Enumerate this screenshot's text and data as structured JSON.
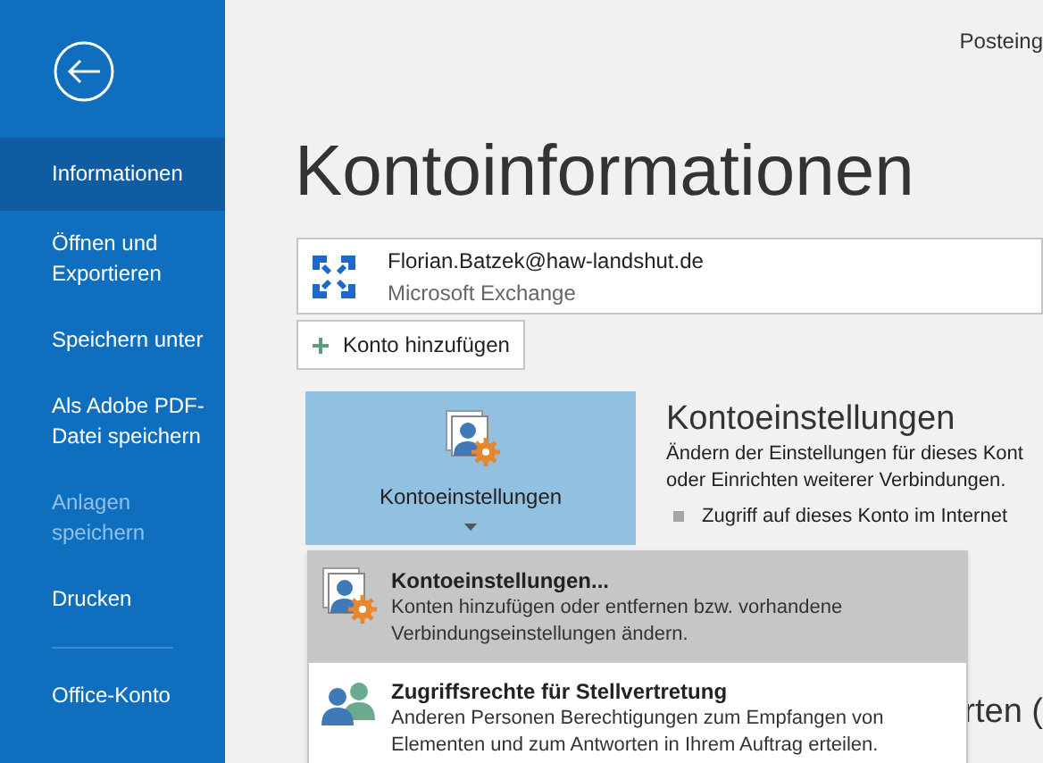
{
  "nav": {
    "items": [
      {
        "kind": "item",
        "label": "Informationen",
        "selected": true,
        "disabled": false
      },
      {
        "kind": "item",
        "label": "Öffnen und Exportieren",
        "selected": false,
        "disabled": false
      },
      {
        "kind": "item",
        "label": "Speichern unter",
        "selected": false,
        "disabled": false
      },
      {
        "kind": "item",
        "label": "Als Adobe PDF-Datei speichern",
        "selected": false,
        "disabled": false
      },
      {
        "kind": "item",
        "label": "Anlagen speichern",
        "selected": false,
        "disabled": true
      },
      {
        "kind": "item",
        "label": "Drucken",
        "selected": false,
        "disabled": false
      },
      {
        "kind": "divider"
      },
      {
        "kind": "item",
        "label": "Office-Konto",
        "selected": false,
        "disabled": false
      }
    ]
  },
  "header_right": "Posteing",
  "title": "Kontoinformationen",
  "account": {
    "email": "Florian.Batzek@haw-landshut.de",
    "type": "Microsoft Exchange"
  },
  "add_account_button": "Konto hinzufügen",
  "settings_tile": {
    "label": "Kontoeinstellungen"
  },
  "section": {
    "heading": "Kontoeinstellungen",
    "description": [
      "Ändern der Einstellungen für dieses Kont",
      "oder Einrichten weiterer Verbindungen."
    ],
    "bullet": "Zugriff auf dieses Konto im Internet"
  },
  "menu": {
    "items": [
      {
        "title": "Kontoeinstellungen...",
        "description": "Konten hinzufügen oder entfernen bzw. vorhandene Verbindungseinstellungen ändern.",
        "kind": "settings",
        "selected": true
      },
      {
        "title": "Zugriffsrechte für Stellvertretung",
        "description": "Anderen Personen Berechtigungen zum Empfangen von Elementen und zum Antworten in Ihrem Auftrag erteilen.",
        "kind": "people",
        "selected": false
      }
    ]
  },
  "background_heading_fragment": "rten ("
}
